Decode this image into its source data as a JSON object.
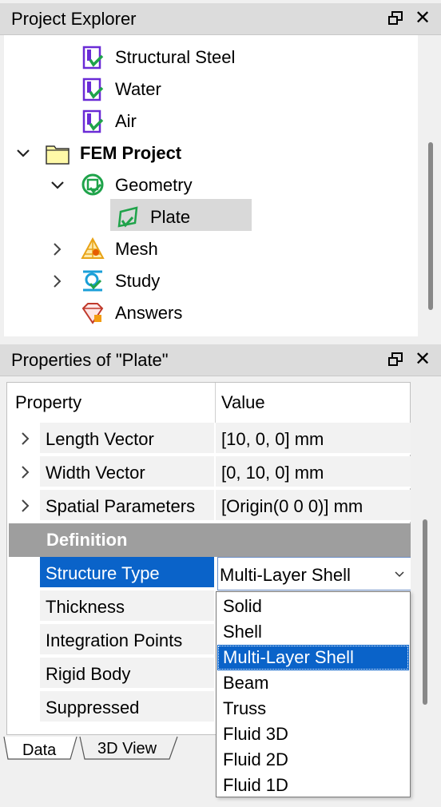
{
  "explorer": {
    "title": "Project Explorer",
    "items": [
      {
        "label": "Structural Steel",
        "icon": "material-icon"
      },
      {
        "label": "Water",
        "icon": "material-icon"
      },
      {
        "label": "Air",
        "icon": "material-icon"
      },
      {
        "label": "FEM Project",
        "icon": "folder-icon"
      },
      {
        "label": "Geometry",
        "icon": "geometry-icon"
      },
      {
        "label": "Plate",
        "icon": "plate-icon"
      },
      {
        "label": "Mesh",
        "icon": "mesh-icon"
      },
      {
        "label": "Study",
        "icon": "study-icon"
      },
      {
        "label": "Answers",
        "icon": "answers-icon"
      }
    ]
  },
  "properties": {
    "title": "Properties of \"Plate\"",
    "col_property": "Property",
    "col_value": "Value",
    "rows": [
      {
        "name": "Length Vector",
        "value": "[10, 0, 0] mm"
      },
      {
        "name": "Width Vector",
        "value": "[0, 10, 0] mm"
      },
      {
        "name": "Spatial Parameters",
        "value": "[Origin(0 0 0)] mm"
      }
    ],
    "group": "Definition",
    "def_rows": [
      {
        "name": "Structure Type",
        "value": "Multi-Layer Shell"
      },
      {
        "name": "Thickness",
        "value": ""
      },
      {
        "name": "Integration Points",
        "value": ""
      },
      {
        "name": "Rigid Body",
        "value": ""
      },
      {
        "name": "Suppressed",
        "value": ""
      }
    ]
  },
  "dropdown": {
    "options": [
      "Solid",
      "Shell",
      "Multi-Layer Shell",
      "Beam",
      "Truss",
      "Fluid 3D",
      "Fluid 2D",
      "Fluid 1D"
    ],
    "selected": "Multi-Layer Shell"
  },
  "tabs": [
    "Data",
    "3D View"
  ],
  "colors": {
    "selection": "#0a63c9",
    "group": "#9e9e9e",
    "icon_purple": "#6a2bd6",
    "icon_green": "#1fa34a"
  }
}
